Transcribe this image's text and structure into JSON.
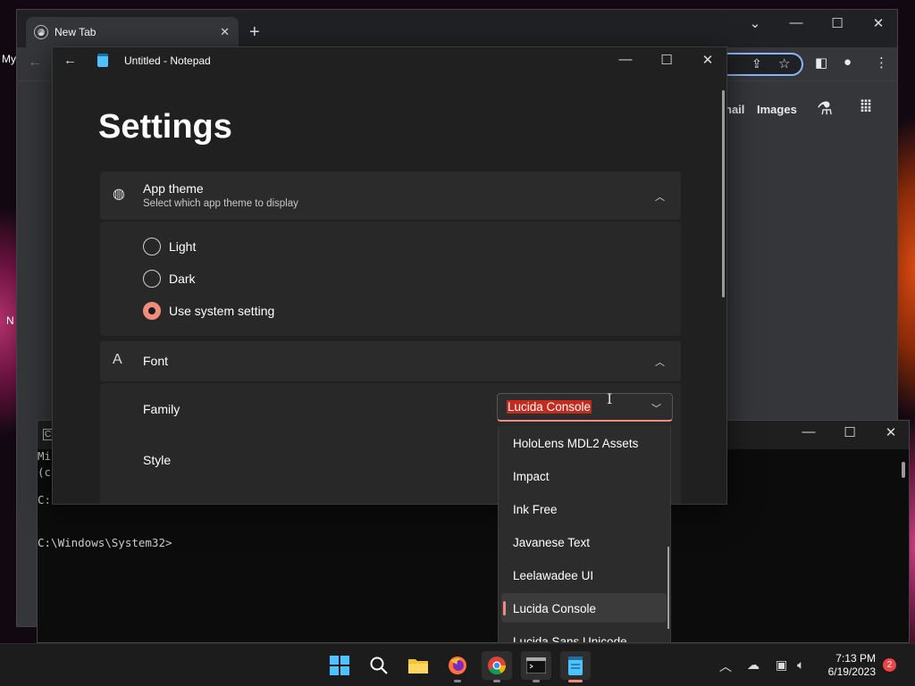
{
  "desktop": {
    "frag_my": "My",
    "frag_n": "N"
  },
  "chrome": {
    "tab_title": "New Tab",
    "tab_close": "✕",
    "new_tab": "+",
    "dropdown_btn": "⌄",
    "minimize": "—",
    "maximize": "☐",
    "close": "✕",
    "ntp_gmail_partial": "nail",
    "ntp_images": "Images"
  },
  "console": {
    "line1": "Mi",
    "line2": "(c",
    "line3": "C:",
    "prompt": "C:\\Windows\\System32>",
    "icon_text": "C",
    "minimize": "—",
    "maximize": "☐",
    "close": "✕"
  },
  "notepad": {
    "title": "Untitled - Notepad",
    "back": "←",
    "minimize": "—",
    "maximize": "☐",
    "close": "✕",
    "settings_title": "Settings",
    "app_theme": {
      "title": "App theme",
      "subtitle": "Select which app theme to display",
      "options": [
        "Light",
        "Dark",
        "Use system setting"
      ],
      "selected": "Use system setting"
    },
    "font": {
      "title": "Font",
      "family_label": "Family",
      "family_value": "Lucida Console",
      "style_label": "Style"
    }
  },
  "dropdown": {
    "items": [
      "HoloLens MDL2 Assets",
      "Impact",
      "Ink Free",
      "Javanese Text",
      "Leelawadee UI",
      "Lucida Console",
      "Lucida Sans Unicode"
    ],
    "selected": "Lucida Console"
  },
  "taskbar": {
    "time": "7:13 PM",
    "date": "6/19/2023",
    "notifications": "2"
  },
  "colors": {
    "accent": "#f08c7c",
    "selection": "#c42b1c",
    "chrome_focus": "#8ab4f8"
  }
}
